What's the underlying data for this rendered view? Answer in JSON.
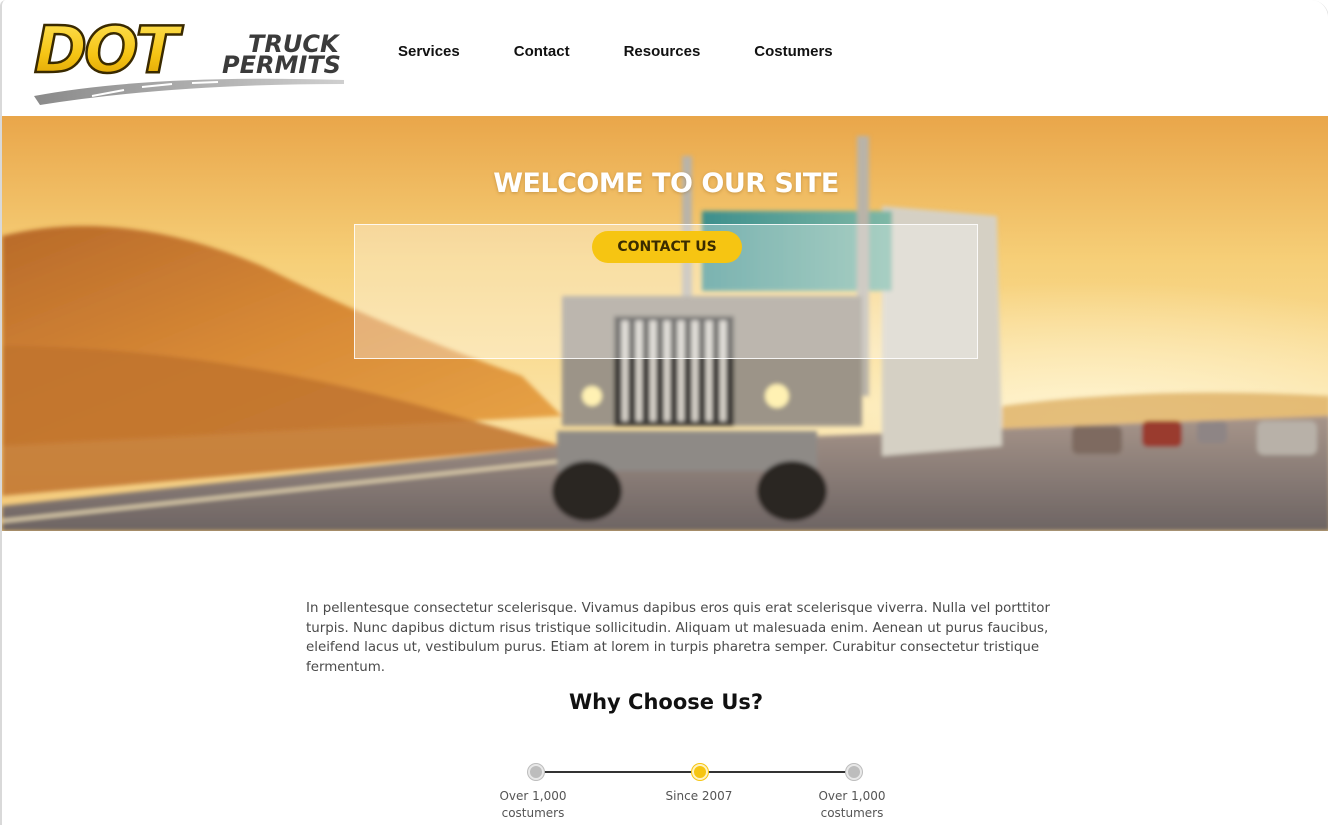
{
  "header": {
    "logo": {
      "main_text": "DOT",
      "line1": "TRUCK",
      "line2": "PERMITS"
    },
    "nav": [
      {
        "label": "Services"
      },
      {
        "label": "Contact"
      },
      {
        "label": "Resources"
      },
      {
        "label": "Costumers"
      }
    ]
  },
  "hero": {
    "title": "WELCOME TO OUR SITE",
    "cta_label": "CONTACT US"
  },
  "intro": {
    "text": "In pellentesque consectetur scelerisque. Vivamus dapibus eros quis erat scelerisque viverra. Nulla vel porttitor turpis. Nunc dapibus dictum risus tristique sollicitudin. Aliquam ut malesuada enim. Aenean ut purus faucibus, eleifend lacus ut, vestibulum purus. Etiam at lorem in turpis pharetra semper. Curabitur consectetur tristique fermentum."
  },
  "why": {
    "title": "Why Choose Us?",
    "timeline": [
      {
        "label_line1": "Over 1,000",
        "label_line2": "costumers",
        "state": "inactive"
      },
      {
        "label_line1": "Since 2007",
        "label_line2": "",
        "state": "active"
      },
      {
        "label_line1": "Over 1,000",
        "label_line2": "costumers",
        "state": "inactive"
      }
    ]
  },
  "colors": {
    "accent": "#f6c512",
    "timeline_inactive": "#bdbdbd"
  }
}
